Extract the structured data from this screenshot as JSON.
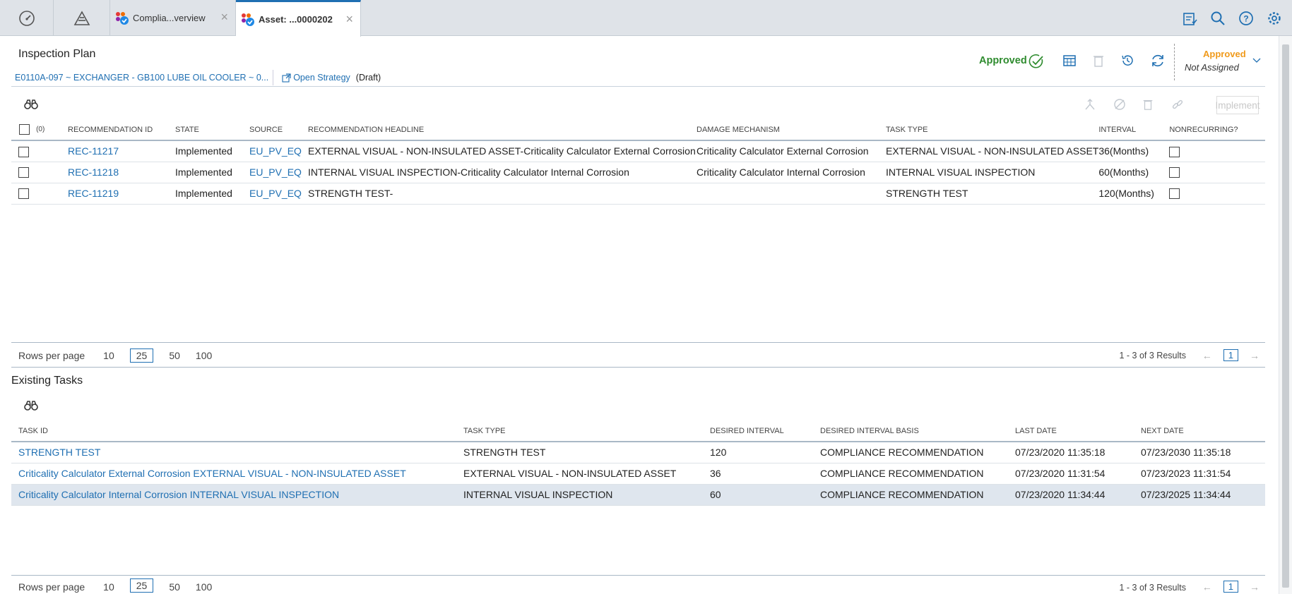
{
  "tabs": {
    "compliance_label": "Complia...verview",
    "asset_label": "Asset: ...0000202"
  },
  "header": {
    "title": "Inspection Plan",
    "asset_link": "E0110A-097 ~ EXCHANGER - GB100 LUBE OIL COOLER ~ 0...",
    "open_strategy": "Open Strategy",
    "draft": "(Draft)",
    "status": "Approved",
    "state": "Approved",
    "assignee": "Not Assigned"
  },
  "recommendations": {
    "implement_label": "Implement",
    "selected_count": "(0)",
    "columns": [
      "RECOMMENDATION ID",
      "STATE",
      "SOURCE",
      "RECOMMENDATION HEADLINE",
      "DAMAGE MECHANISM",
      "TASK TYPE",
      "INTERVAL",
      "NONRECURRING?"
    ],
    "rows": [
      {
        "id": "REC-11217",
        "state": "Implemented",
        "source": "EU_PV_EQ",
        "headline": "EXTERNAL VISUAL - NON-INSULATED ASSET-Criticality Calculator External Corrosion",
        "damage": "Criticality Calculator External Corrosion",
        "task_type": "EXTERNAL VISUAL - NON-INSULATED ASSET",
        "interval": "36(Months)"
      },
      {
        "id": "REC-11218",
        "state": "Implemented",
        "source": "EU_PV_EQ",
        "headline": "INTERNAL VISUAL INSPECTION-Criticality Calculator Internal Corrosion",
        "damage": "Criticality Calculator Internal Corrosion",
        "task_type": "INTERNAL VISUAL INSPECTION",
        "interval": "60(Months)"
      },
      {
        "id": "REC-11219",
        "state": "Implemented",
        "source": "EU_PV_EQ",
        "headline": "STRENGTH TEST-",
        "damage": "",
        "task_type": "STRENGTH TEST",
        "interval": "120(Months)"
      }
    ]
  },
  "pager": {
    "rows_per_page": "Rows per page",
    "sizes": [
      "10",
      "25",
      "50",
      "100"
    ],
    "results": "1 - 3 of 3 Results",
    "page": "1"
  },
  "existing_tasks": {
    "title": "Existing Tasks",
    "columns": [
      "TASK ID",
      "TASK TYPE",
      "DESIRED INTERVAL",
      "DESIRED INTERVAL BASIS",
      "LAST DATE",
      "NEXT DATE"
    ],
    "rows": [
      {
        "task_id": "STRENGTH TEST",
        "task_type": "STRENGTH TEST",
        "interval": "120",
        "basis": "COMPLIANCE RECOMMENDATION",
        "last": "07/23/2020 11:35:18",
        "next": "07/23/2030 11:35:18"
      },
      {
        "task_id": "Criticality Calculator External Corrosion EXTERNAL VISUAL - NON-INSULATED ASSET",
        "task_type": "EXTERNAL VISUAL - NON-INSULATED ASSET",
        "interval": "36",
        "basis": "COMPLIANCE RECOMMENDATION",
        "last": "07/23/2020 11:31:54",
        "next": "07/23/2023 11:31:54"
      },
      {
        "task_id": "Criticality Calculator Internal Corrosion INTERNAL VISUAL INSPECTION",
        "task_type": "INTERNAL VISUAL INSPECTION",
        "interval": "60",
        "basis": "COMPLIANCE RECOMMENDATION",
        "last": "07/23/2020 11:34:44",
        "next": "07/23/2025 11:34:44"
      }
    ]
  },
  "colors": {
    "accent": "#1f6fb2",
    "approved": "#2e8b2e",
    "state": "#f09a1b"
  }
}
